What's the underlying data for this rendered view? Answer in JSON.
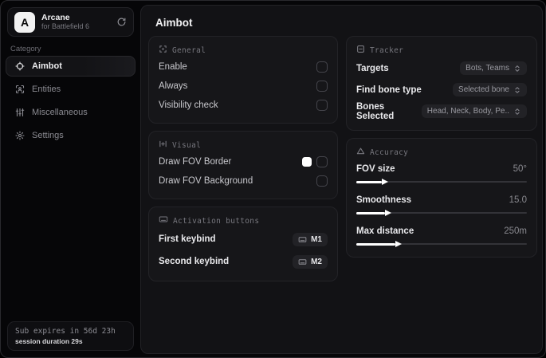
{
  "sidebar": {
    "logo_letter": "A",
    "title": "Arcane",
    "subtitle": "for Battlefield 6",
    "category_label": "Category",
    "items": [
      {
        "label": "Aimbot",
        "icon": "crosshair-icon",
        "selected": true
      },
      {
        "label": "Entities",
        "icon": "person-scan-icon",
        "selected": false
      },
      {
        "label": "Miscellaneous",
        "icon": "sliders-icon",
        "selected": false
      },
      {
        "label": "Settings",
        "icon": "gear-icon",
        "selected": false
      }
    ],
    "footer": {
      "sub_expiry": "Sub expires in 56d 23h",
      "session_duration": "session duration 29s"
    }
  },
  "main": {
    "title": "Aimbot",
    "sections": {
      "general": {
        "title": "General",
        "rows": [
          {
            "label": "Enable",
            "checked": false
          },
          {
            "label": "Always",
            "checked": false
          },
          {
            "label": "Visibility check",
            "checked": false
          }
        ]
      },
      "visual": {
        "title": "Visual",
        "rows": [
          {
            "label": "Draw FOV Border",
            "swatch": "#ffffff",
            "checked": false
          },
          {
            "label": "Draw FOV Background",
            "checked": false
          }
        ]
      },
      "activation": {
        "title": "Activation buttons",
        "rows": [
          {
            "label": "First keybind",
            "key": "M1"
          },
          {
            "label": "Second keybind",
            "key": "M2"
          }
        ]
      },
      "tracker": {
        "title": "Tracker",
        "rows": [
          {
            "label": "Targets",
            "value": "Bots, Teams"
          },
          {
            "label": "Find bone type",
            "value": "Selected bone"
          },
          {
            "label": "Bones Selected",
            "value": "Head, Neck, Body, Pe.."
          }
        ]
      },
      "accuracy": {
        "title": "Accuracy",
        "rows": [
          {
            "label": "FOV size",
            "value": "50°",
            "percent": 15
          },
          {
            "label": "Smoothness",
            "value": "15.0",
            "percent": 17
          },
          {
            "label": "Max distance",
            "value": "250m",
            "percent": 23
          }
        ]
      }
    }
  },
  "colors": {
    "accent": "#ffffff",
    "panel": "#121215",
    "card": "#161619"
  }
}
